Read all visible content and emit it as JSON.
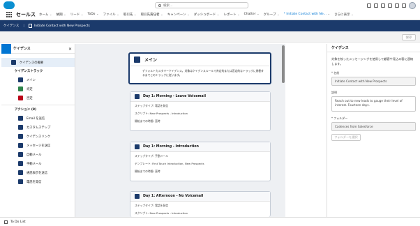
{
  "app": {
    "name": "セールス",
    "search_placeholder": "検索..."
  },
  "nav": {
    "items": [
      "ホーム",
      "納期",
      "リード",
      "ToDo",
      "ファイル",
      "取引先",
      "取引先責任者",
      "キャンペーン",
      "ダッシュボード",
      "レポート",
      "Chatter",
      "グループ",
      "* Initiate Contact with Ne...",
      "さらに表示"
    ]
  },
  "breadcrumb": {
    "root": "ケイデンス",
    "current": "Initiate Contact with New Prospects"
  },
  "toolbar": {
    "save": "保存"
  },
  "left_panel": {
    "title": "ケイデンス",
    "overview": "ケイデンスの概要",
    "tracks_title": "ケイデンストラック",
    "tracks": [
      {
        "label": "メイン",
        "color": "#1b3a6b"
      },
      {
        "label": "肯定",
        "color": "#2e844a"
      },
      {
        "label": "否定",
        "color": "#ba0517"
      }
    ],
    "actions_title": "アクション (8)",
    "actions": [
      {
        "label": "Email を送信",
        "color": "#1b3a6b"
      },
      {
        "label": "カスタムステップ",
        "color": "#1b3a6b"
      },
      {
        "label": "ケイデンスリンク",
        "color": "#1b3a6b"
      },
      {
        "label": "メッセージを送信",
        "color": "#1b3a6b"
      },
      {
        "label": "自動メール",
        "color": "#1b3a6b"
      },
      {
        "label": "手動メール",
        "color": "#1b3a6b"
      },
      {
        "label": "通話表示を送信",
        "color": "#1b3a6b"
      },
      {
        "label": "電話を発信",
        "color": "#1b3a6b"
      }
    ]
  },
  "main": {
    "title": "メイン",
    "desc": "デフォルトカスタマーケイデンス。対象はケイデンスルールで肯定的または否定的なトラックに移動するまでこのトラックに従います。",
    "steps": [
      {
        "title": "Day 1: Morning - Leave Voicemail",
        "r1": "ステップタイプ: 電話を発信",
        "r2": "スクリプト: New Prospects - Introduction",
        "r3": "開始までの時間: 直時"
      },
      {
        "title": "Day 1: Morning - Introduction",
        "r1": "ステップタイプ: 手動メール",
        "r2": "テンプレート: First Touch Introduction, New Prospects",
        "r3": "開始までの時間: 直時"
      },
      {
        "title": "Day 1: Afternoon - No Voicemail",
        "r1": "ステップタイプ: 電話を発信",
        "r2": "スクリプト: New Prospects - Introduction",
        "r3": ""
      }
    ]
  },
  "right_panel": {
    "title": "ケイデンス",
    "desc": "対象を絞ったメッセージングを使用して顧客や見込み客に連絡します。",
    "name_label": "* 名前",
    "name_value": "Initiate Contact with New Prospects",
    "desc_label": "説明",
    "desc_value": "Reach out to new leads to gauge their level of interest. Fourteen days.",
    "folder_label": "* フォルダー",
    "folder_value": "Cadences from Salesforce",
    "folder_button": "フォルダーを選択"
  },
  "footer": {
    "label": "To Do List"
  }
}
